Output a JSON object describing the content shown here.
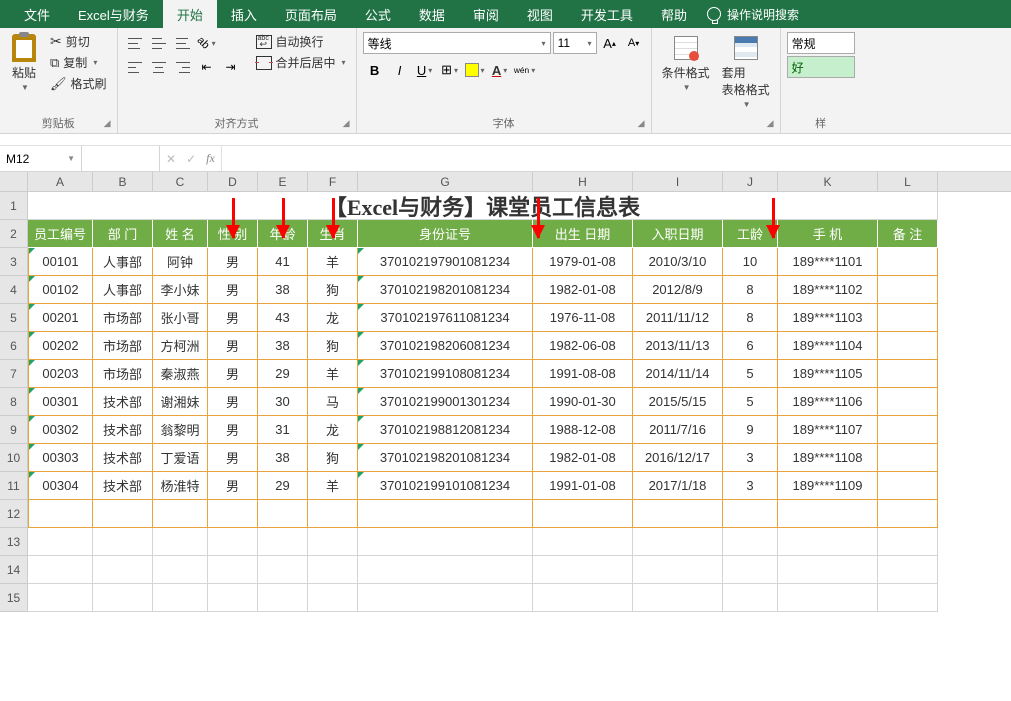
{
  "tabs": [
    "文件",
    "Excel与财务",
    "开始",
    "插入",
    "页面布局",
    "公式",
    "数据",
    "审阅",
    "视图",
    "开发工具",
    "帮助"
  ],
  "activeTab": 2,
  "tellme": "操作说明搜索",
  "clipboard": {
    "paste": "粘贴",
    "cut": "剪切",
    "copy": "复制",
    "brush": "格式刷",
    "label": "剪贴板"
  },
  "align": {
    "wrap": "自动换行",
    "merge": "合并后居中",
    "label": "对齐方式"
  },
  "font": {
    "name": "等线",
    "size": "11",
    "label": "字体"
  },
  "styles": {
    "cond": "条件格式",
    "table": "套用\n表格格式",
    "label": "样",
    "normal": "常规",
    "good": "好"
  },
  "namebox": "M12",
  "colLetters": [
    "A",
    "B",
    "C",
    "D",
    "E",
    "F",
    "G",
    "H",
    "I",
    "J",
    "K",
    "L"
  ],
  "tableTitle": "【Excel与财务】课堂员工信息表",
  "headers": [
    "员工编号",
    "部 门",
    "姓 名",
    "性 别",
    "年龄",
    "生肖",
    "身份证号",
    "出生 日期",
    "入职日期",
    "工龄",
    "手 机",
    "备 注"
  ],
  "rows": [
    {
      "id": "00101",
      "dept": "人事部",
      "name": "阿钟",
      "sex": "男",
      "age": "41",
      "zodiac": "羊",
      "idno": "370102197901081234",
      "birth": "1979-01-08",
      "hire": "2010/3/10",
      "years": "10",
      "phone": "189****1101"
    },
    {
      "id": "00102",
      "dept": "人事部",
      "name": "李小妹",
      "sex": "男",
      "age": "38",
      "zodiac": "狗",
      "idno": "370102198201081234",
      "birth": "1982-01-08",
      "hire": "2012/8/9",
      "years": "8",
      "phone": "189****1102"
    },
    {
      "id": "00201",
      "dept": "市场部",
      "name": "张小哥",
      "sex": "男",
      "age": "43",
      "zodiac": "龙",
      "idno": "370102197611081234",
      "birth": "1976-11-08",
      "hire": "2011/11/12",
      "years": "8",
      "phone": "189****1103"
    },
    {
      "id": "00202",
      "dept": "市场部",
      "name": "方柯洲",
      "sex": "男",
      "age": "38",
      "zodiac": "狗",
      "idno": "370102198206081234",
      "birth": "1982-06-08",
      "hire": "2013/11/13",
      "years": "6",
      "phone": "189****1104"
    },
    {
      "id": "00203",
      "dept": "市场部",
      "name": "秦淑燕",
      "sex": "男",
      "age": "29",
      "zodiac": "羊",
      "idno": "370102199108081234",
      "birth": "1991-08-08",
      "hire": "2014/11/14",
      "years": "5",
      "phone": "189****1105"
    },
    {
      "id": "00301",
      "dept": "技术部",
      "name": "谢湘妹",
      "sex": "男",
      "age": "30",
      "zodiac": "马",
      "idno": "370102199001301234",
      "birth": "1990-01-30",
      "hire": "2015/5/15",
      "years": "5",
      "phone": "189****1106"
    },
    {
      "id": "00302",
      "dept": "技术部",
      "name": "翁黎明",
      "sex": "男",
      "age": "31",
      "zodiac": "龙",
      "idno": "370102198812081234",
      "birth": "1988-12-08",
      "hire": "2011/7/16",
      "years": "9",
      "phone": "189****1107"
    },
    {
      "id": "00303",
      "dept": "技术部",
      "name": "丁爱语",
      "sex": "男",
      "age": "38",
      "zodiac": "狗",
      "idno": "370102198201081234",
      "birth": "1982-01-08",
      "hire": "2016/12/17",
      "years": "3",
      "phone": "189****1108"
    },
    {
      "id": "00304",
      "dept": "技术部",
      "name": "杨淮特",
      "sex": "男",
      "age": "29",
      "zodiac": "羊",
      "idno": "370102199101081234",
      "birth": "1991-01-08",
      "hire": "2017/1/18",
      "years": "3",
      "phone": "189****1109"
    }
  ],
  "arrowCols": [
    "D",
    "E",
    "F",
    "H",
    "J"
  ]
}
